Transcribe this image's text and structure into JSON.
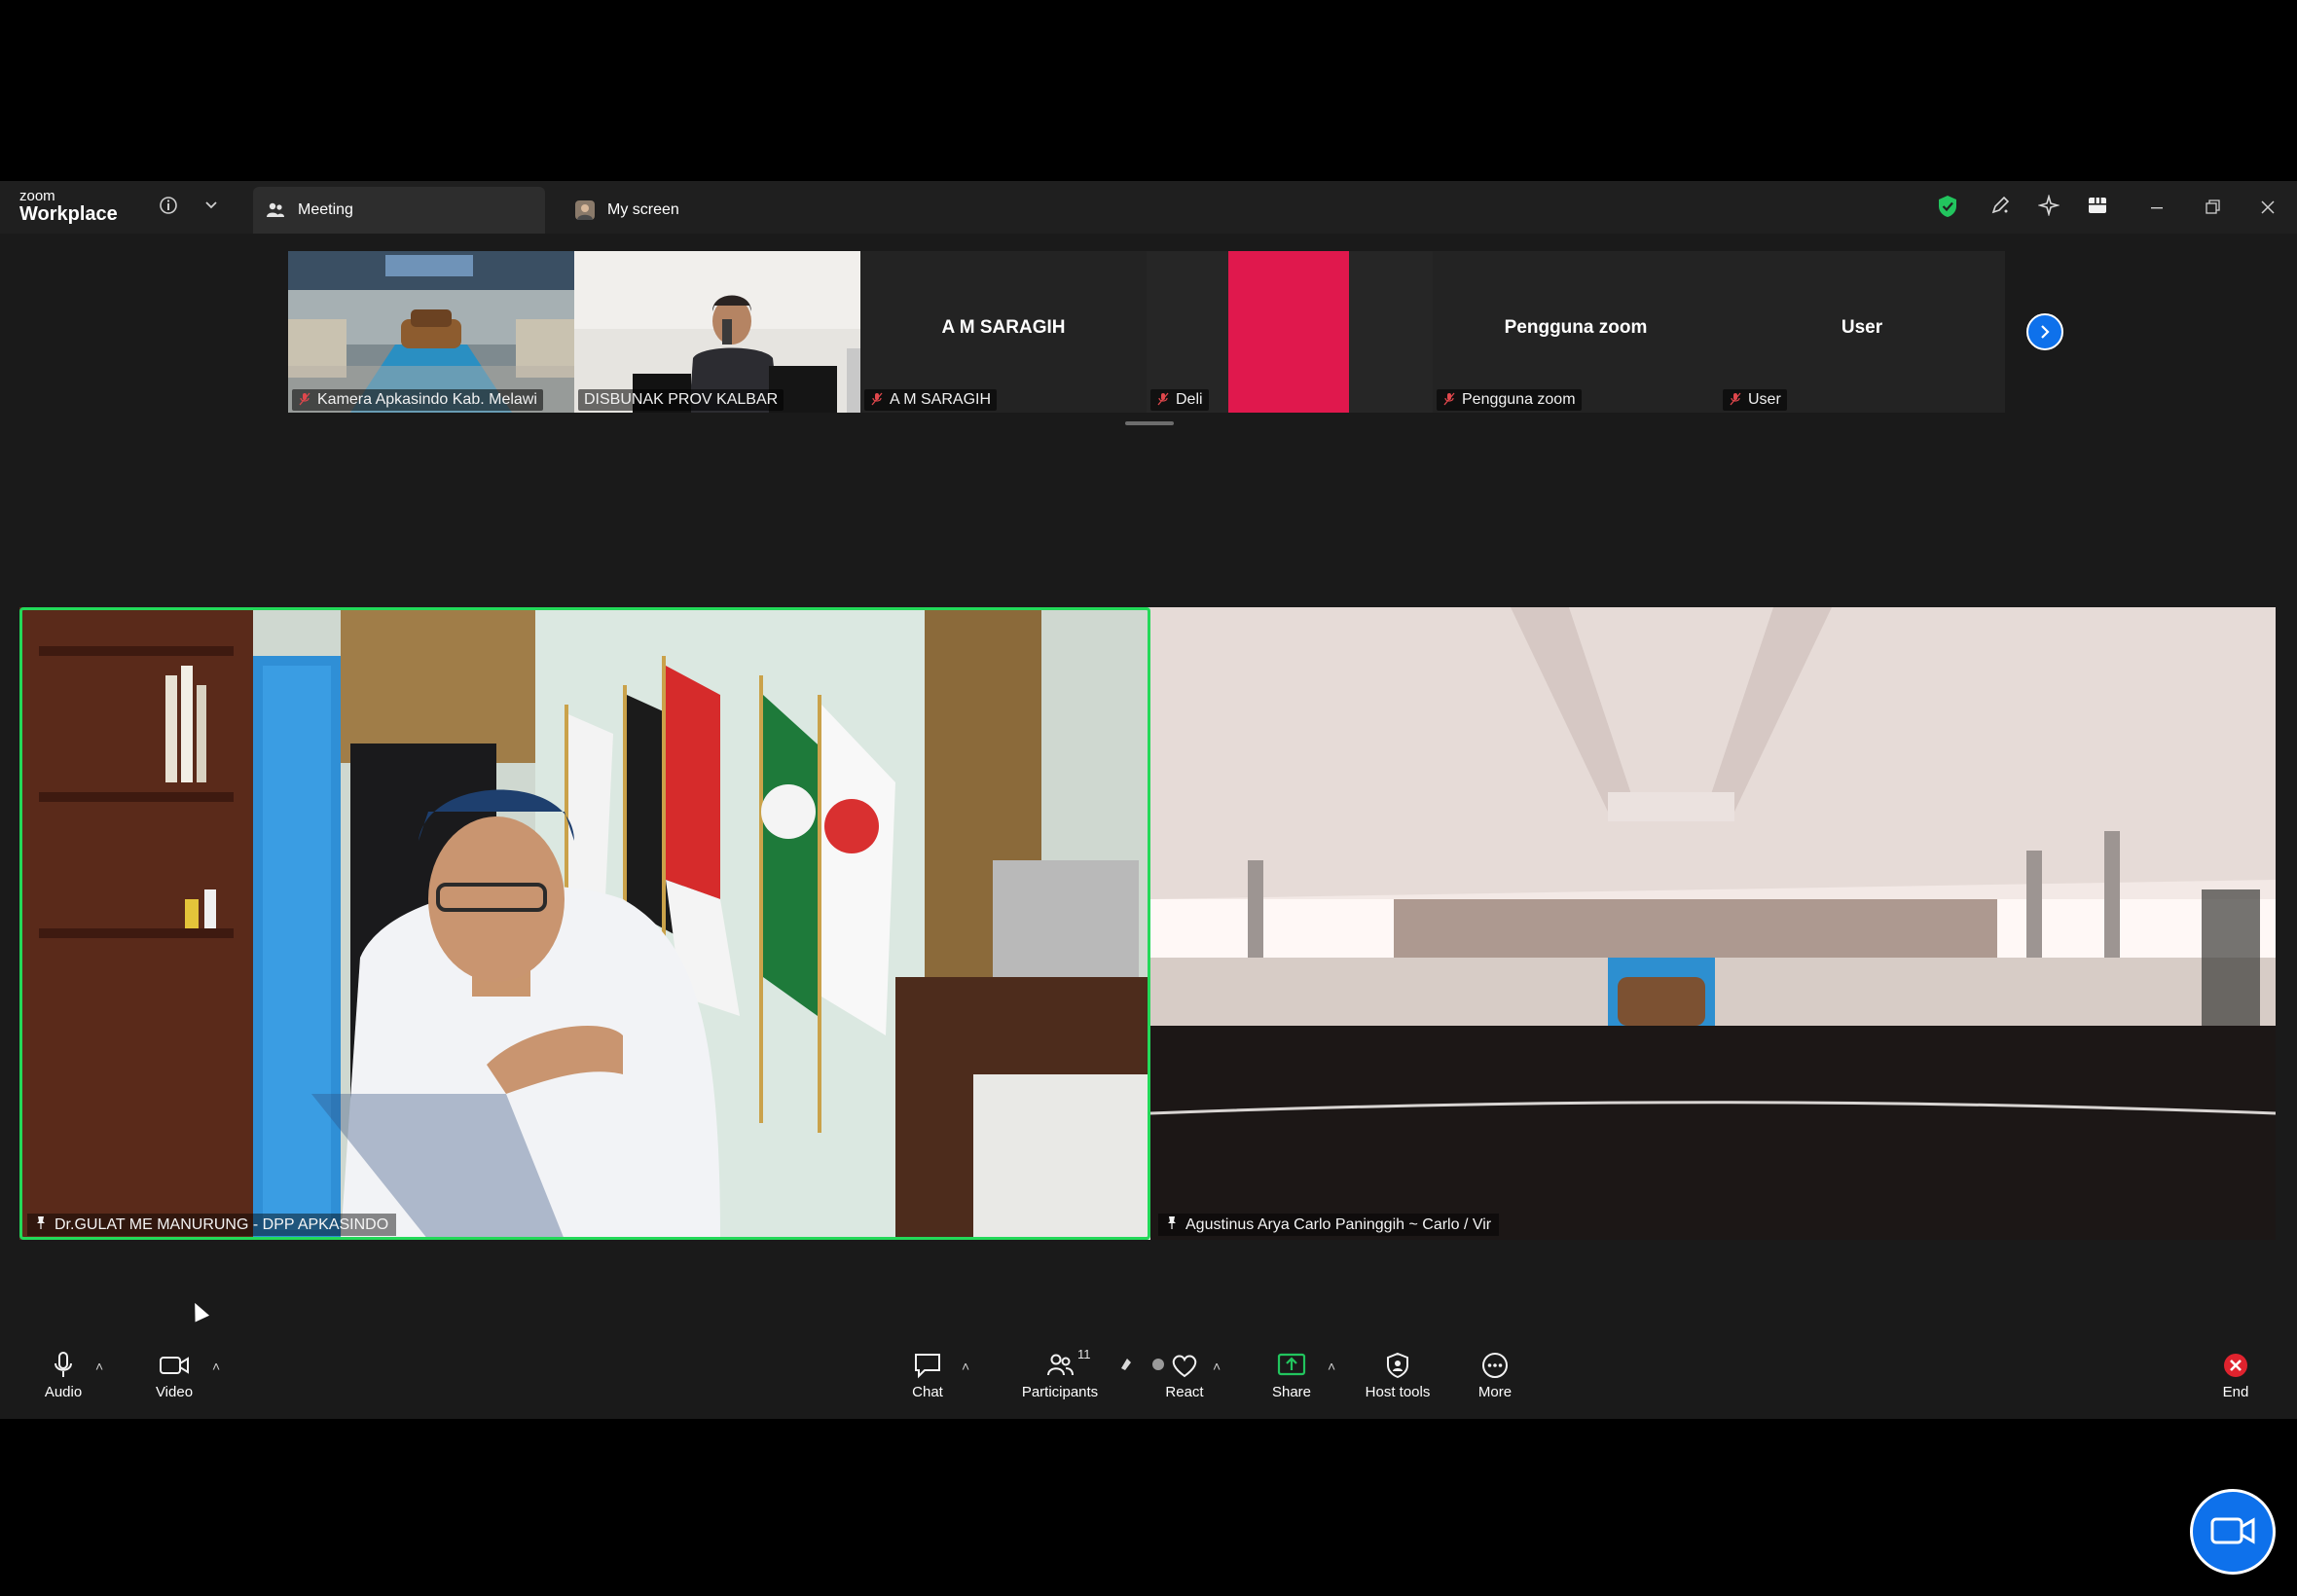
{
  "app": {
    "brand_small": "zoom",
    "brand_big": "Workplace"
  },
  "tabs": [
    {
      "label": "Meeting",
      "icon": "people-icon",
      "active": true
    },
    {
      "label": "My screen",
      "icon": "avatar-icon",
      "active": false
    }
  ],
  "title_icons": [
    "info-icon",
    "chevron-down-icon",
    "shield-check-icon",
    "pen-icon",
    "sparkle-icon",
    "grid-view-icon"
  ],
  "window_buttons": [
    "minimize-icon",
    "restore-icon",
    "close-icon"
  ],
  "thumbnails": [
    {
      "name": "Kamera Apkasindo Kab. Melawi",
      "muted": true,
      "has_video": true
    },
    {
      "name": "DISBUNAK PROV KALBAR",
      "muted": false,
      "has_video": true
    },
    {
      "name": "A M SARAGIH",
      "center_name": "A M SARAGIH",
      "muted": true,
      "has_video": false
    },
    {
      "name": "Deli",
      "muted": true,
      "has_video": true
    },
    {
      "name": "Pengguna zoom",
      "center_name": "Pengguna zoom",
      "muted": true,
      "has_video": false
    },
    {
      "name": "User",
      "center_name": "User",
      "muted": true,
      "has_video": false
    }
  ],
  "main_tiles": [
    {
      "name": "Dr.GULAT ME MANURUNG - DPP APKASINDO",
      "active_speaker": true
    },
    {
      "name": "Agustinus Arya Carlo Paninggih ~ Carlo / Vir",
      "active_speaker": false
    }
  ],
  "controls": {
    "audio": "Audio",
    "video": "Video",
    "chat": "Chat",
    "participants": "Participants",
    "participants_count": "11",
    "react": "React",
    "share": "Share",
    "host_tools": "Host tools",
    "more": "More",
    "end": "End"
  },
  "colors": {
    "active_speaker_border": "#23d959",
    "accent_blue": "#0e71eb",
    "end_red": "#e0232e",
    "muted_red": "#e0474c",
    "share_green": "#22c55e"
  }
}
